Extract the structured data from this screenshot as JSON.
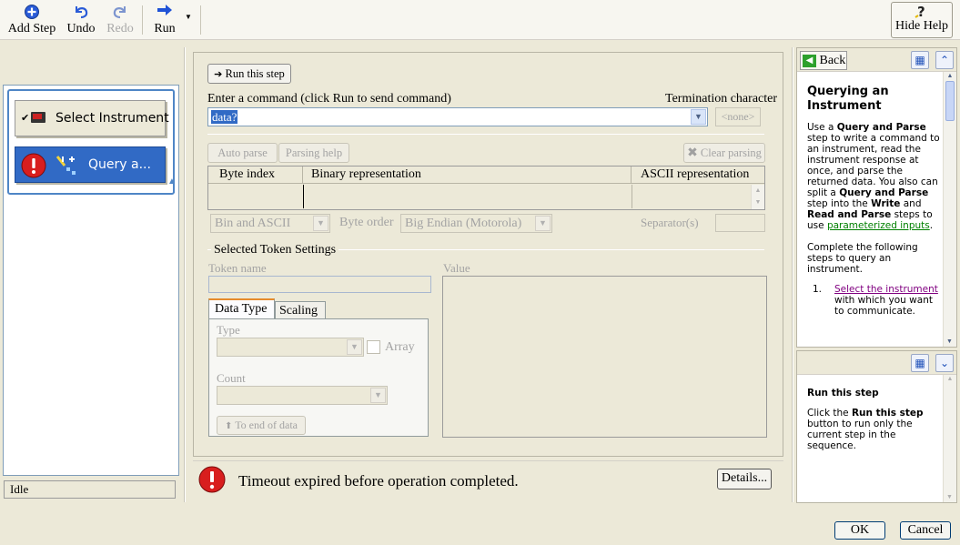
{
  "toolbar": {
    "add_step": "Add Step",
    "undo": "Undo",
    "redo": "Redo",
    "run": "Run",
    "hide_help": "Hide Help"
  },
  "sequence": {
    "steps": [
      {
        "label": "Select Instrument",
        "state": "normal"
      },
      {
        "label": "Query a...",
        "state": "error-selected"
      }
    ],
    "status": "Idle"
  },
  "step_config": {
    "run_step_button": "Run this step",
    "command_label": "Enter a command (click Run to send command)",
    "termination_label": "Termination character",
    "command_value": "data?",
    "termination_value": "<none>",
    "auto_parse": "Auto parse",
    "parsing_help": "Parsing help",
    "clear_parsing": "Clear parsing",
    "table_headers": [
      "Byte index",
      "Binary representation",
      "ASCII representation"
    ],
    "format_value": "Bin and ASCII",
    "byte_order_label": "Byte order",
    "byte_order_value": "Big Endian (Motorola)",
    "separator_label": "Separator(s)",
    "token_settings_label": "Selected Token Settings",
    "token_name_label": "Token name",
    "value_label": "Value",
    "tabs": [
      "Data Type",
      "Scaling"
    ],
    "type_label": "Type",
    "array_label": "Array",
    "count_label": "Count",
    "to_end_button": "To end of data",
    "error_message": "Timeout expired before operation completed.",
    "details_button": "Details..."
  },
  "help": {
    "back": "Back",
    "title": "Querying an Instrument",
    "bottom_title": "Run this step"
  },
  "dialog": {
    "ok": "OK",
    "cancel": "Cancel"
  },
  "colors": {
    "error_red": "#d81e1e",
    "selection_blue": "#316ac5",
    "link_green": "#008000"
  }
}
